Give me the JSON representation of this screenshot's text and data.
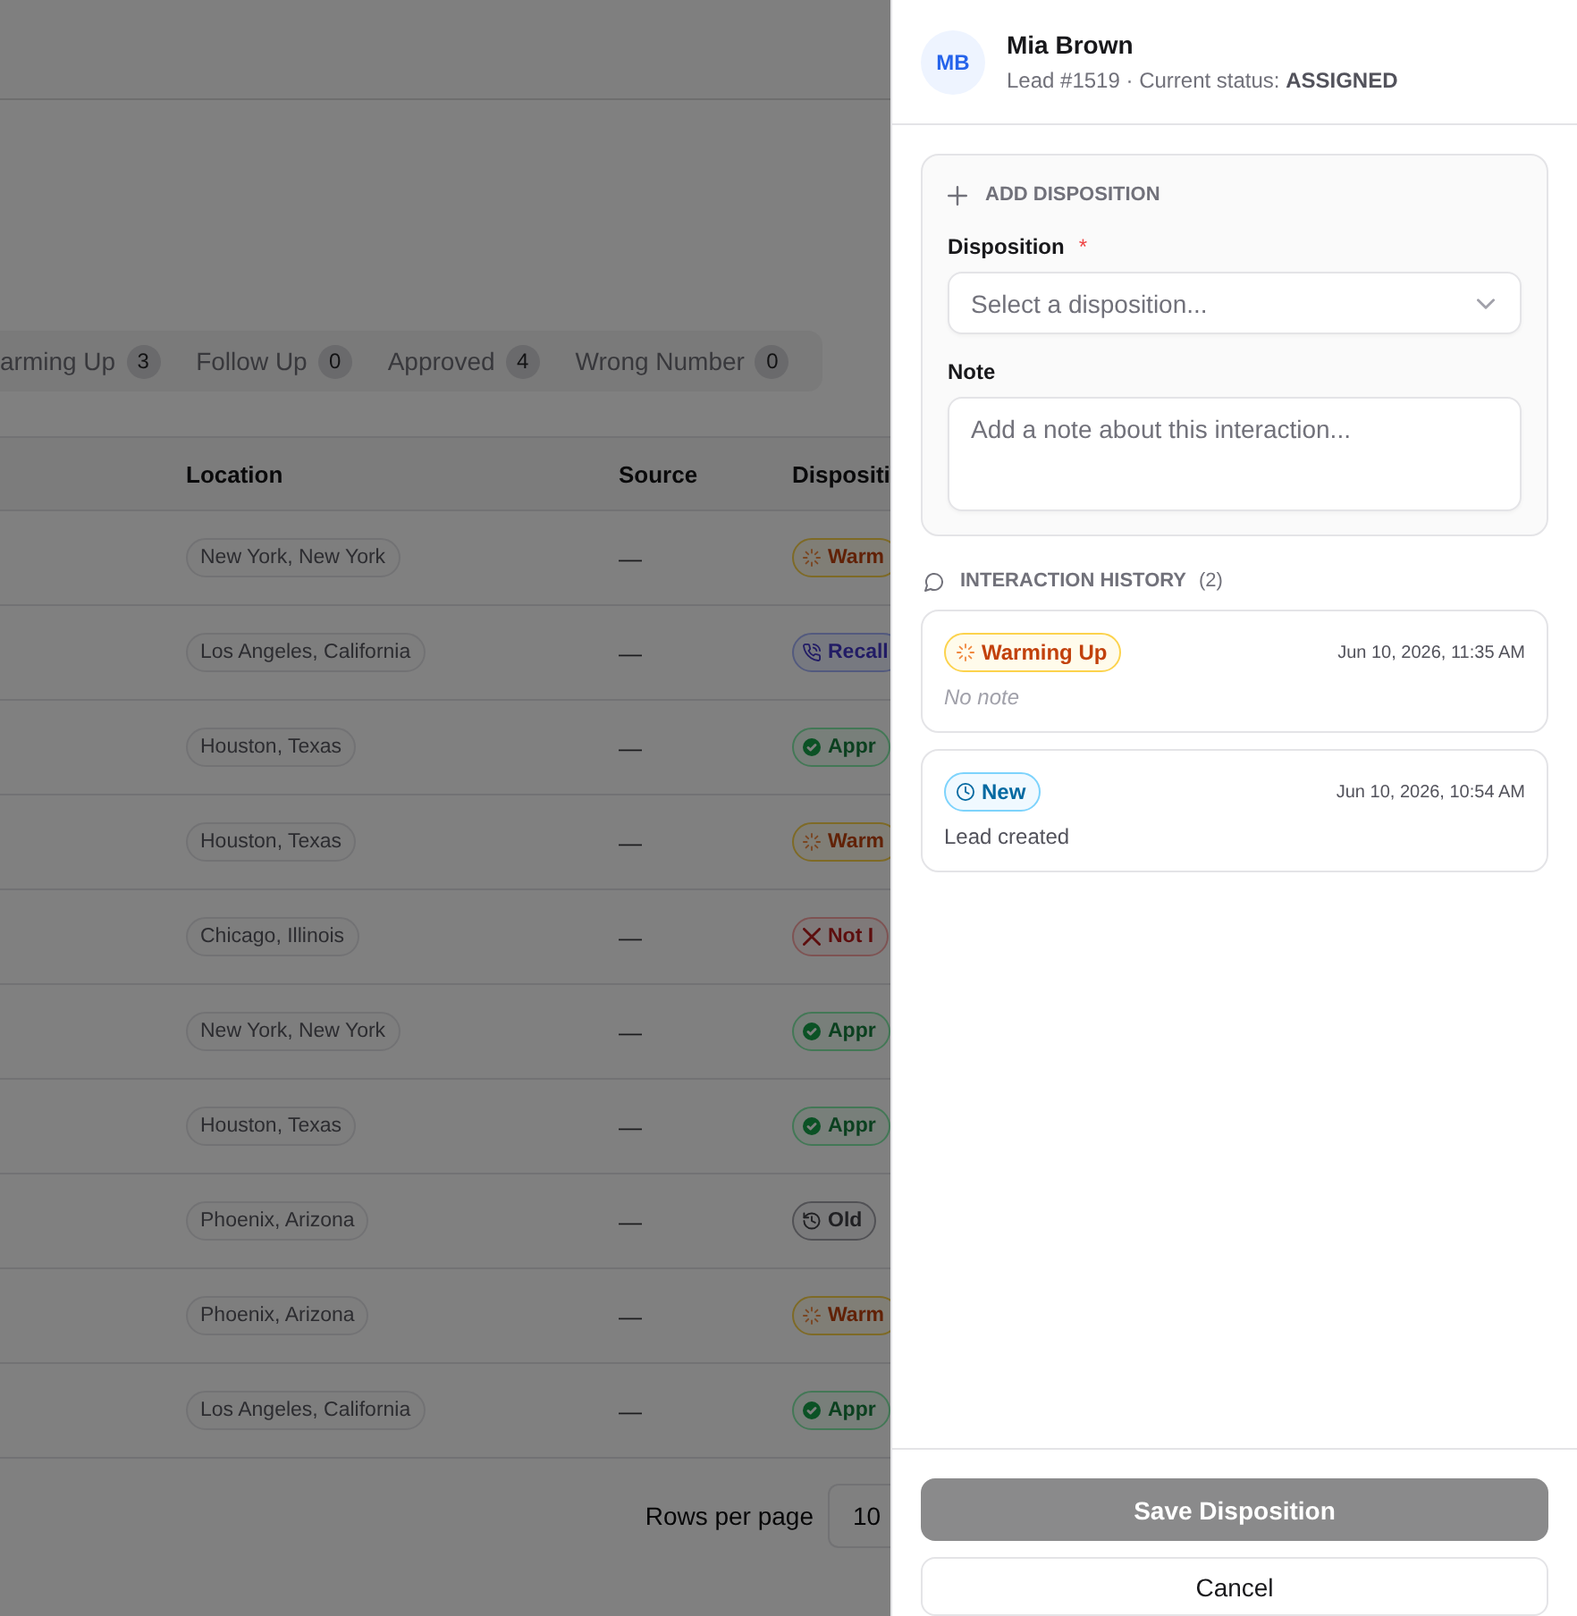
{
  "filter_tabs": [
    {
      "label": "arming Up",
      "count": "3",
      "selected": false
    },
    {
      "label": "Follow Up",
      "count": "0",
      "selected": false
    },
    {
      "label": "Approved",
      "count": "4",
      "selected": false
    },
    {
      "label": "Wrong Number",
      "count": "0",
      "selected": false
    }
  ],
  "table": {
    "columns": [
      "Location",
      "Source",
      "Dispositi"
    ],
    "rows": [
      {
        "location": "New York, New York",
        "source": "—",
        "disposition": {
          "kind": "warming_up",
          "label": "Warm"
        }
      },
      {
        "location": "Los Angeles, California",
        "source": "—",
        "disposition": {
          "kind": "recall",
          "label": "Recall"
        }
      },
      {
        "location": "Houston, Texas",
        "source": "—",
        "disposition": {
          "kind": "approved",
          "label": "Appr"
        }
      },
      {
        "location": "Houston, Texas",
        "source": "—",
        "disposition": {
          "kind": "warming_up",
          "label": "Warm"
        }
      },
      {
        "location": "Chicago, Illinois",
        "source": "—",
        "disposition": {
          "kind": "not_interested",
          "label": "Not I"
        }
      },
      {
        "location": "New York, New York",
        "source": "—",
        "disposition": {
          "kind": "approved",
          "label": "Appr"
        }
      },
      {
        "location": "Houston, Texas",
        "source": "—",
        "disposition": {
          "kind": "approved",
          "label": "Appr"
        }
      },
      {
        "location": "Phoenix, Arizona",
        "source": "—",
        "disposition": {
          "kind": "old",
          "label": "Old"
        }
      },
      {
        "location": "Phoenix, Arizona",
        "source": "—",
        "disposition": {
          "kind": "warming_up",
          "label": "Warm"
        }
      },
      {
        "location": "Los Angeles, California",
        "source": "—",
        "disposition": {
          "kind": "approved",
          "label": "Appr"
        }
      }
    ]
  },
  "pagination": {
    "label": "Rows per page",
    "value": "10"
  },
  "drawer": {
    "avatar": "MB",
    "name": "Mia Brown",
    "subtitle": "Lead #1519 · Current status: **ASSIGNED**",
    "form": {
      "title": "ADD DISPOSITION",
      "disposition_label": "Disposition",
      "required_mark": "*",
      "disposition_placeholder": "Select a disposition...",
      "note_label": "Note",
      "note_placeholder": "Add a note about this interaction..."
    },
    "history": {
      "title": "INTERACTION HISTORY",
      "count": "(2)",
      "entries": [
        {
          "status": {
            "kind": "warming_up",
            "label": "Warming Up"
          },
          "time": "Jun 10, 2026, 11:35 AM",
          "note": "No note",
          "muted": true
        },
        {
          "status": {
            "kind": "new",
            "label": "New"
          },
          "time": "Jun 10, 2026, 10:54 AM",
          "note": "Lead created",
          "muted": false
        }
      ]
    },
    "buttons": [
      {
        "label": "Save Disposition",
        "kind": "primary",
        "disabled": true
      },
      {
        "label": "Cancel",
        "kind": "secondary",
        "disabled": false
      }
    ]
  }
}
